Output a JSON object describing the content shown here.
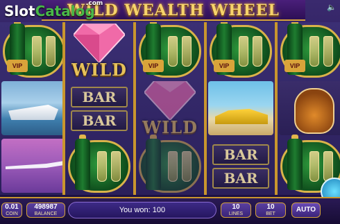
{
  "game": {
    "title": "WILD WEALTH WHEEL"
  },
  "watermark": {
    "slot": "Slot",
    "catalog": "Catalog",
    "com": ".com"
  },
  "symbols": {
    "wild_label": "WILD",
    "bar_label": "BAR",
    "vip_label": "VIP"
  },
  "controls": {
    "bet_level_value": "0.01",
    "bet_level_label": "COIN",
    "balance_value": "498987",
    "balance_label": "BALANCE",
    "win_message": "You won: 100",
    "lines_value": "10",
    "lines_label": "LINES",
    "bet_value": "10",
    "bet_label": "BET",
    "auto_label": "AUTO"
  },
  "icons": {
    "sound": "speaker-icon"
  },
  "colors": {
    "gold": "#d4a23a",
    "purple": "#3a2478",
    "green": "#49b848"
  }
}
